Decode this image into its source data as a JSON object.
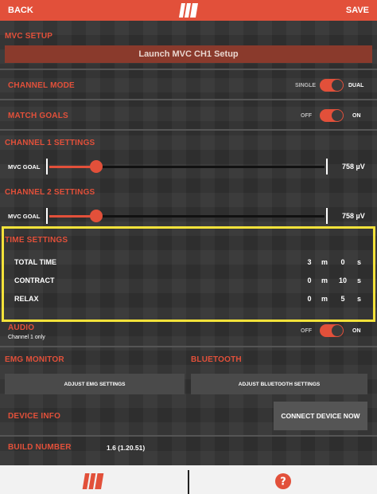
{
  "topbar": {
    "back_label": "BACK",
    "save_label": "SAVE",
    "logo_icon": "brand-logo-icon",
    "color": "#e2503a"
  },
  "mvc_setup": {
    "title": "MVC SETUP",
    "launch_button": "Launch MVC CH1 Setup"
  },
  "channel_mode": {
    "title": "CHANNEL MODE",
    "off_label": "SINGLE",
    "on_label": "DUAL",
    "state": "DUAL"
  },
  "match_goals": {
    "title": "MATCH GOALS",
    "off_label": "OFF",
    "on_label": "ON",
    "state": "ON"
  },
  "channel1": {
    "title": "CHANNEL 1 SETTINGS",
    "goal_label": "MVC GOAL",
    "value": "758",
    "unit": "µV",
    "slider_level": 0.17
  },
  "channel2": {
    "title": "CHANNEL 2 SETTINGS",
    "goal_label": "MVC GOAL",
    "value": "758",
    "unit": "µV",
    "slider_level": 0.17
  },
  "time_settings": {
    "title": "TIME SETTINGS",
    "rows": [
      {
        "label": "TOTAL TIME",
        "minutes": "3",
        "m": "m",
        "seconds": "0",
        "s": "s"
      },
      {
        "label": "CONTRACT",
        "minutes": "0",
        "m": "m",
        "seconds": "10",
        "s": "s"
      },
      {
        "label": "RELAX",
        "minutes": "0",
        "m": "m",
        "seconds": "5",
        "s": "s"
      }
    ],
    "highlight_color": "#f3e23a"
  },
  "audio": {
    "title": "AUDIO",
    "subtitle": "Channel 1 only",
    "off_label": "OFF",
    "on_label": "ON",
    "state": "ON"
  },
  "emg_monitor": {
    "title": "EMG MONITOR",
    "button": "ADJUST EMG SETTINGS"
  },
  "bluetooth": {
    "title": "BLUETOOTH",
    "button": "ADJUST BLUETOOTH SETTINGS"
  },
  "device_info": {
    "title": "DEVICE INFO",
    "button": "CONNECT DEVICE NOW"
  },
  "build": {
    "title": "BUILD NUMBER",
    "value": "1.6 (1.20.51)"
  },
  "bottombar": {
    "home_icon": "brand-logo-icon",
    "help_icon": "help-icon"
  }
}
